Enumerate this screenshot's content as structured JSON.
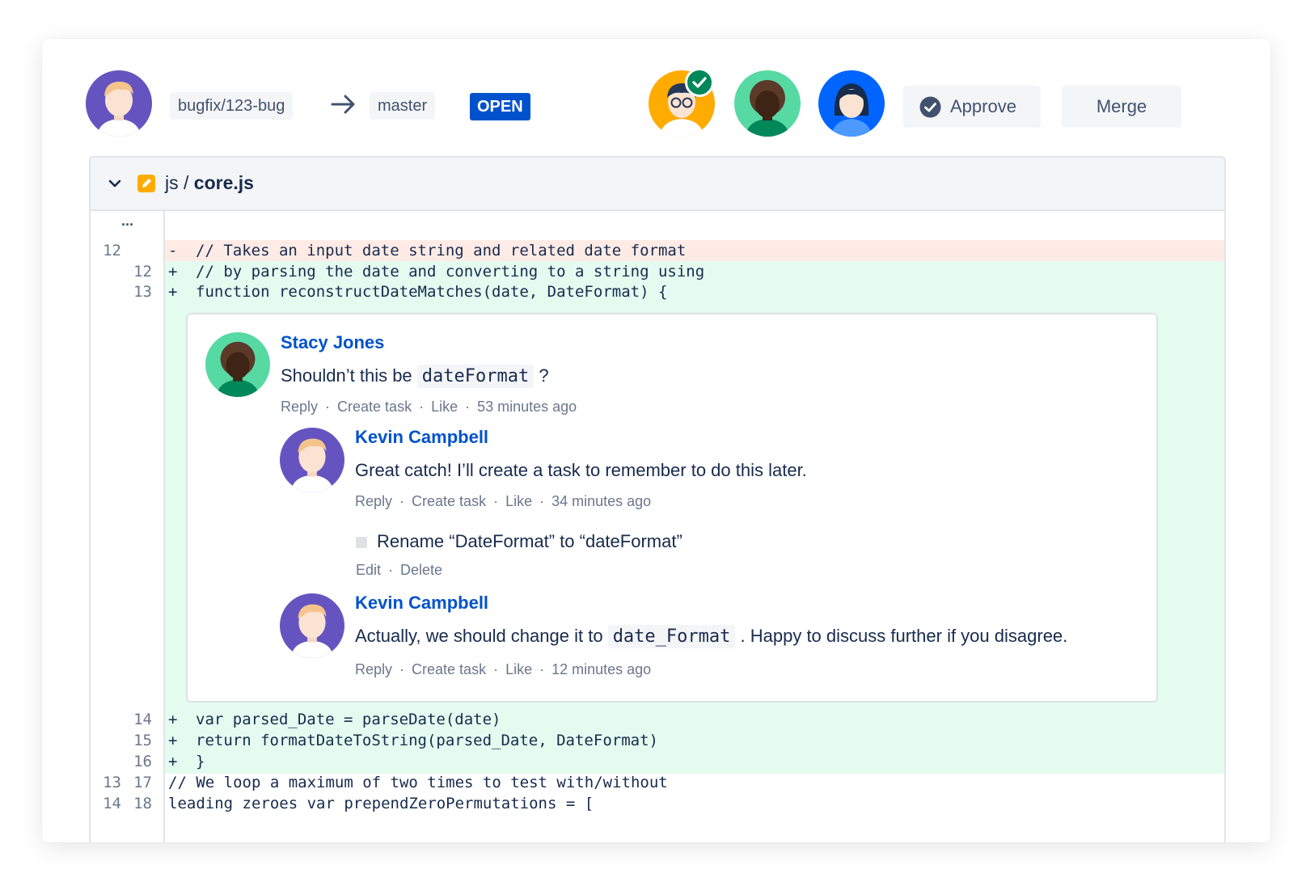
{
  "header": {
    "source_branch": "bugfix/123-bug",
    "target_branch": "master",
    "status": "OPEN",
    "approve_label": "Approve",
    "merge_label": "Merge"
  },
  "file": {
    "dir": "js /",
    "name": "core.js",
    "expand": "..."
  },
  "diff_top": [
    {
      "old": "12",
      "new": "",
      "sign": "-",
      "type": "del",
      "code": "// Takes an input date string and related date format"
    },
    {
      "old": "",
      "new": "12",
      "sign": "+",
      "type": "add",
      "code": "// by parsing the date and converting to a string using"
    },
    {
      "old": "",
      "new": "13",
      "sign": "+",
      "type": "add",
      "code": "function reconstructDateMatches(date, DateFormat) {"
    }
  ],
  "diff_bottom": [
    {
      "old": "",
      "new": "14",
      "sign": "+",
      "type": "add",
      "code": "var parsed_Date = parseDate(date)"
    },
    {
      "old": "",
      "new": "15",
      "sign": "+",
      "type": "add",
      "code": "return formatDateToString(parsed_Date, DateFormat)"
    },
    {
      "old": "",
      "new": "16",
      "sign": "+",
      "type": "add",
      "code": "}"
    },
    {
      "old": "13",
      "new": "17",
      "sign": "",
      "type": "ctx",
      "code": "// We loop a maximum of two times to test with/without"
    },
    {
      "old": "14",
      "new": "18",
      "sign": "",
      "type": "ctx",
      "code": "leading zeroes var prependZeroPermutations = ["
    }
  ],
  "comments": {
    "c1": {
      "author": "Stacy Jones",
      "text_before": "Shouldn’t this be",
      "code": "dateFormat",
      "text_after": "?",
      "reply": "Reply",
      "create_task": "Create task",
      "like": "Like",
      "sep": "·",
      "time": "53 minutes ago"
    },
    "c2": {
      "author": "Kevin Campbell",
      "text": "Great catch! I’ll create a task to remember to do this later.",
      "reply": "Reply",
      "create_task": "Create task",
      "like": "Like",
      "sep": "·",
      "time": "34 minutes ago"
    },
    "task": {
      "text": "Rename “DateFormat” to “dateFormat”",
      "edit": "Edit",
      "delete": "Delete",
      "sep": "·"
    },
    "c3": {
      "author": "Kevin Campbell",
      "text_before": "Actually, we should change it to",
      "code": "date_Format",
      "text_after": ". Happy to discuss further if you disagree.",
      "reply": "Reply",
      "create_task": "Create task",
      "like": "Like",
      "sep": "·",
      "time": "12 minutes ago"
    }
  },
  "colors": {
    "brand_blue": "#0052cc",
    "approved_green": "#00875a",
    "added_bg": "#e3fcef",
    "removed_bg": "#ffebe6"
  }
}
